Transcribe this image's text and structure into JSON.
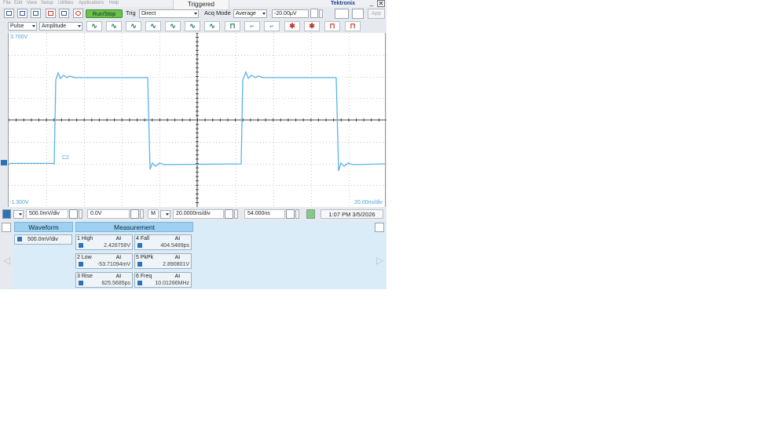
{
  "menu": [
    "File",
    "Edit",
    "View",
    "Setup",
    "Utilities",
    "Applications",
    "Help"
  ],
  "status": "Triggered",
  "brand": "Tektronix",
  "window_buttons": [
    "_",
    "✕"
  ],
  "toolbar1": {
    "run_stop": "Run/Stop",
    "trig_label": "Trig",
    "trig_mode": "Direct",
    "acq_label": "Acq Mode",
    "acq_mode": "Average",
    "trig_level": "-20.00μV",
    "app": "App"
  },
  "toolbar2": {
    "trigger_type": "Pulse",
    "pulse_class": "Amplitude"
  },
  "scope": {
    "top_scale": "3.700V",
    "bottom_scale": "-1.300V",
    "timebase_label": "20.00ns/div",
    "channel_label": "C2",
    "trace_color": "#5ab4e6"
  },
  "settings": {
    "vertical_scale": "500.0mV/div",
    "offset": "0.0V",
    "menu_btn": "M",
    "horizontal_scale": "20.0000ns/div",
    "position": "54.000ns",
    "datetime": "1:07 PM 3/5/2026"
  },
  "panel": {
    "waveform_tab": "Waveform",
    "measurement_tab": "Measurement",
    "waveform_scale": "500.0mV/div",
    "measurements": [
      {
        "name": "1 High",
        "stat": "Al",
        "value": "2.426758V"
      },
      {
        "name": "2 Low",
        "stat": "Al",
        "value": "-53.71094mV"
      },
      {
        "name": "3 Rise",
        "stat": "Al",
        "value": "825.5685ps"
      },
      {
        "name": "4 Fall",
        "stat": "Al",
        "value": "404.5489ps"
      },
      {
        "name": "5 PkPk",
        "stat": "Al",
        "value": "2.890801V"
      },
      {
        "name": "6 Freq",
        "stat": "Al",
        "value": "10.01286MHz"
      }
    ]
  }
}
